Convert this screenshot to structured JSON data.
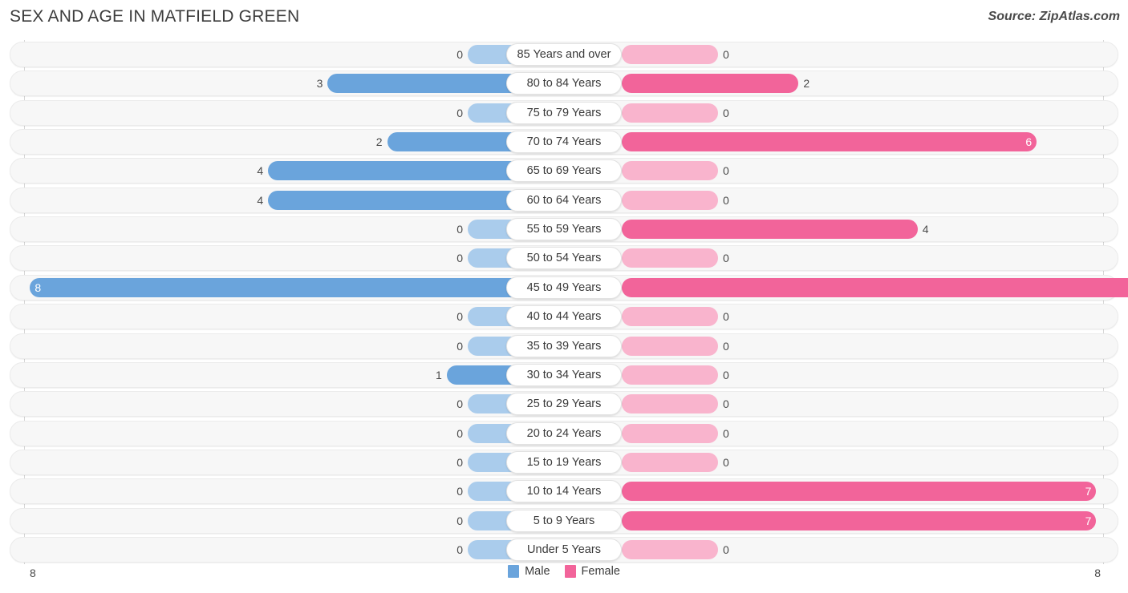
{
  "header": {
    "title": "SEX AND AGE IN MATFIELD GREEN",
    "source": "Source: ZipAtlas.com"
  },
  "legend": {
    "male_label": "Male",
    "female_label": "Female",
    "male_color": "#6aa4dc",
    "female_color": "#f2649a"
  },
  "axis": {
    "left_tick": "8",
    "right_tick": "8"
  },
  "colors": {
    "male_strong": "#6aa4dc",
    "male_light": "#aaccec",
    "female_strong": "#f2649a",
    "female_light": "#f9b4cd",
    "row_track": "#f7f7f7"
  },
  "chart_data": {
    "type": "bar",
    "subtype": "population-pyramid",
    "title": "SEX AND AGE IN MATFIELD GREEN",
    "xlabel": "",
    "ylabel": "",
    "xlim": [
      8,
      8
    ],
    "grid": false,
    "legend_position": "bottom-center",
    "categories": [
      "85 Years and over",
      "80 to 84 Years",
      "75 to 79 Years",
      "70 to 74 Years",
      "65 to 69 Years",
      "60 to 64 Years",
      "55 to 59 Years",
      "50 to 54 Years",
      "45 to 49 Years",
      "40 to 44 Years",
      "35 to 39 Years",
      "30 to 34 Years",
      "25 to 29 Years",
      "20 to 24 Years",
      "15 to 19 Years",
      "10 to 14 Years",
      "5 to 9 Years",
      "Under 5 Years"
    ],
    "series": [
      {
        "name": "Male",
        "color": "#6aa4dc",
        "values": [
          0,
          3,
          0,
          2,
          4,
          4,
          0,
          0,
          8,
          0,
          0,
          1,
          0,
          0,
          0,
          0,
          0,
          0
        ]
      },
      {
        "name": "Female",
        "color": "#f2649a",
        "values": [
          0,
          2,
          0,
          6,
          0,
          0,
          4,
          0,
          8,
          0,
          0,
          0,
          0,
          0,
          0,
          7,
          7,
          0
        ]
      }
    ]
  },
  "rows": [
    {
      "label": "85 Years and over",
      "male": "0",
      "female": "0"
    },
    {
      "label": "80 to 84 Years",
      "male": "3",
      "female": "2"
    },
    {
      "label": "75 to 79 Years",
      "male": "0",
      "female": "0"
    },
    {
      "label": "70 to 74 Years",
      "male": "2",
      "female": "6"
    },
    {
      "label": "65 to 69 Years",
      "male": "4",
      "female": "0"
    },
    {
      "label": "60 to 64 Years",
      "male": "4",
      "female": "0"
    },
    {
      "label": "55 to 59 Years",
      "male": "0",
      "female": "4"
    },
    {
      "label": "50 to 54 Years",
      "male": "0",
      "female": "0"
    },
    {
      "label": "45 to 49 Years",
      "male": "8",
      "female": "8"
    },
    {
      "label": "40 to 44 Years",
      "male": "0",
      "female": "0"
    },
    {
      "label": "35 to 39 Years",
      "male": "0",
      "female": "0"
    },
    {
      "label": "30 to 34 Years",
      "male": "1",
      "female": "0"
    },
    {
      "label": "25 to 29 Years",
      "male": "0",
      "female": "0"
    },
    {
      "label": "20 to 24 Years",
      "male": "0",
      "female": "0"
    },
    {
      "label": "15 to 19 Years",
      "male": "0",
      "female": "0"
    },
    {
      "label": "10 to 14 Years",
      "male": "0",
      "female": "7"
    },
    {
      "label": "5 to 9 Years",
      "male": "0",
      "female": "7"
    },
    {
      "label": "Under 5 Years",
      "male": "0",
      "female": "0"
    }
  ]
}
